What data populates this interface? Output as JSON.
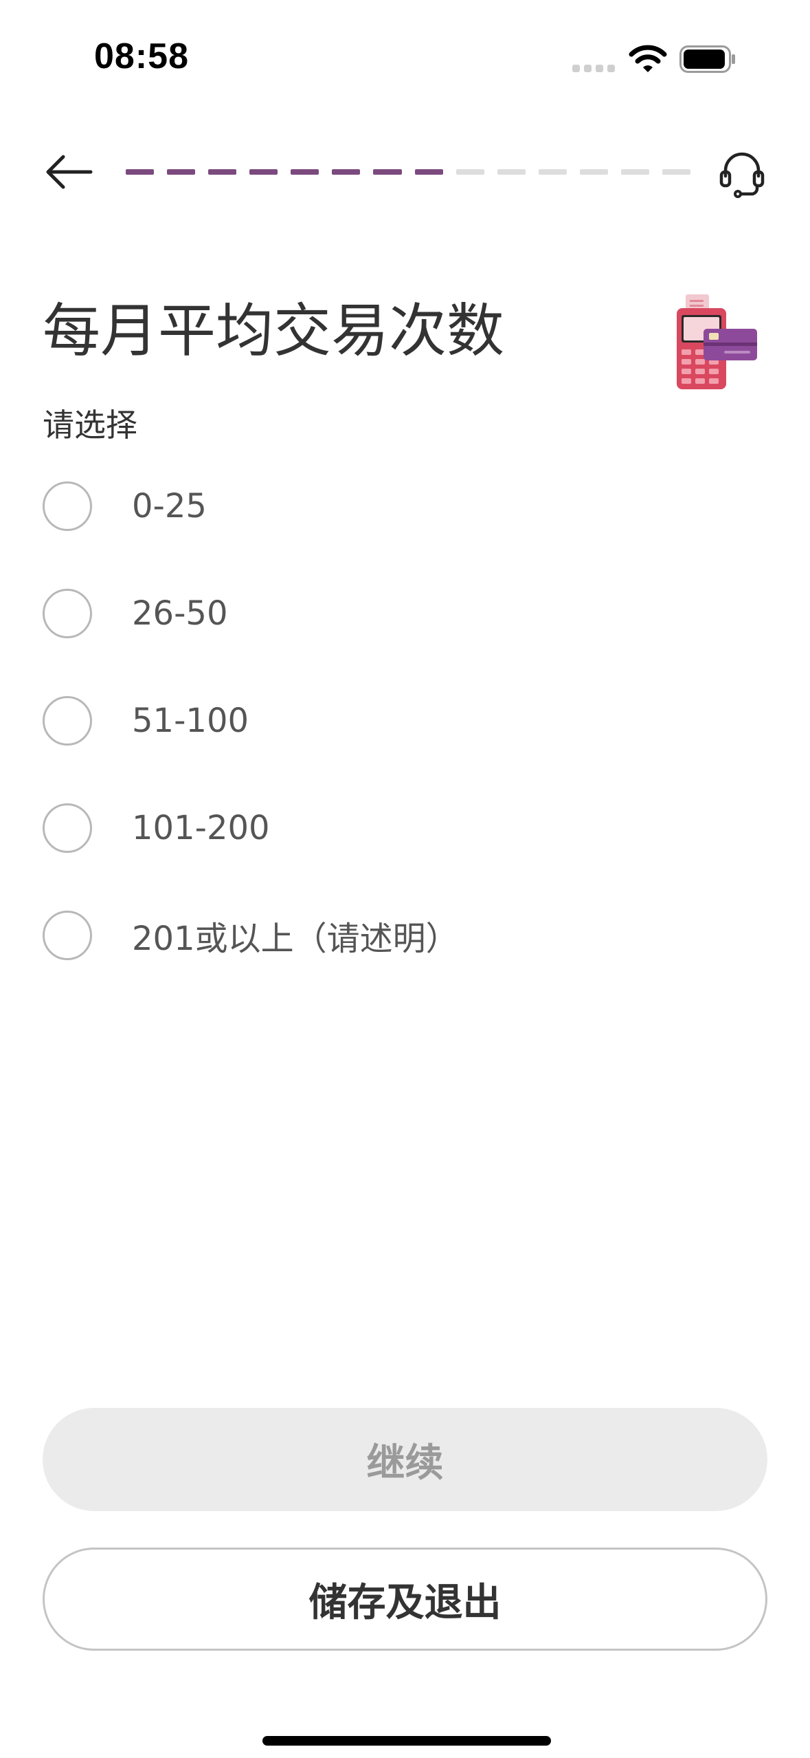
{
  "status_bar": {
    "time": "08:58"
  },
  "colors": {
    "progress_active": "#7b4a7e",
    "progress_inactive": "#dddddd",
    "radio_border": "#b8b8b8",
    "continue_bg": "#ebebeb",
    "continue_text": "#9a9a9a"
  },
  "header": {
    "back_icon": "arrow-left-icon",
    "support_icon": "headset-icon",
    "progress": {
      "completed": 8,
      "total": 14
    }
  },
  "question": {
    "title": "每月平均交易次数",
    "subtitle": "请选择",
    "illustration": "pos-terminal-icon",
    "options": [
      "0-25",
      "26-50",
      "51-100",
      "101-200",
      "201或以上（请述明）"
    ]
  },
  "actions": {
    "continue_label": "继续",
    "save_exit_label": "储存及退出"
  }
}
